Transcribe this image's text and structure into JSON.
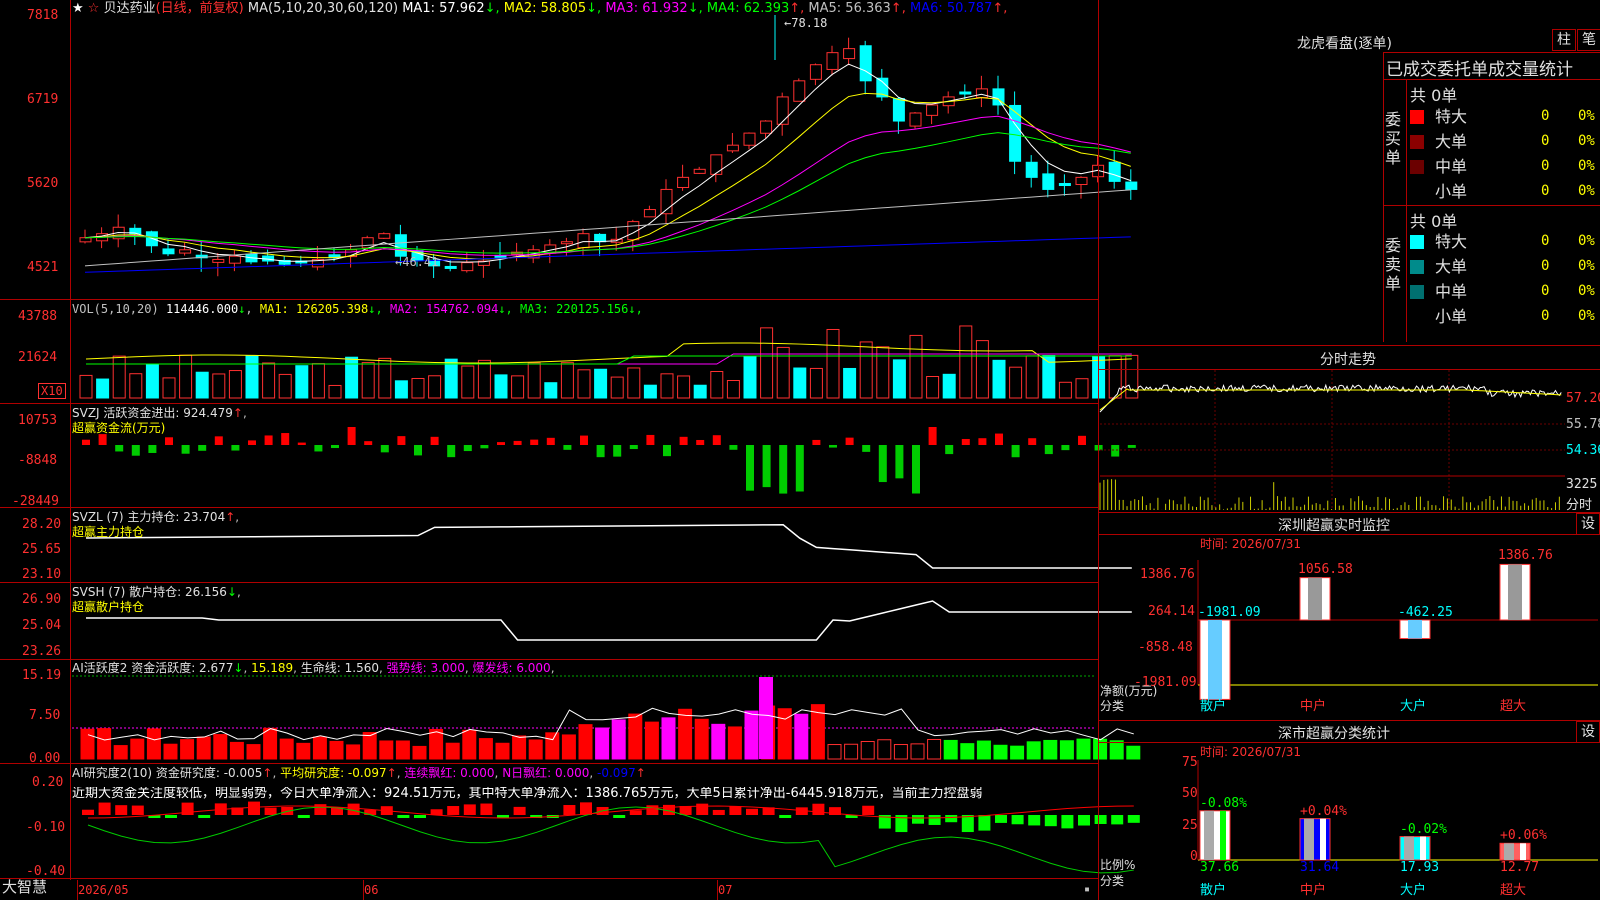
{
  "stock": {
    "name": "贝达药业",
    "period_label": "(日线，前复权)",
    "ma_text": "MA(5,10,20,30,60,120)",
    "ma_values": [
      {
        "label": "MA1:",
        "value": "57.962",
        "dir": "↓",
        "color": "#ffffff"
      },
      {
        "label": "MA2:",
        "value": "58.805",
        "dir": "↓",
        "color": "#ffff00"
      },
      {
        "label": "MA3:",
        "value": "61.932",
        "dir": "↓",
        "color": "#ff00ff"
      },
      {
        "label": "MA4:",
        "value": "62.393",
        "dir": "↑",
        "color": "#00ff00"
      },
      {
        "label": "MA5:",
        "value": "56.363",
        "dir": "↑",
        "color": "#c0c0c0"
      },
      {
        "label": "MA6:",
        "value": "50.787",
        "dir": "↑",
        "color": "#0000ff"
      }
    ],
    "high_marker": "78.18",
    "low_marker": "46.41",
    "y_ticks": [
      "7818",
      "6719",
      "5620",
      "4521"
    ]
  },
  "volume": {
    "title": "VOL(5,10,20)",
    "value": "114446.000",
    "ma": [
      {
        "label": "MA1:",
        "value": "126205.398",
        "color": "#ffff00"
      },
      {
        "label": "MA2:",
        "value": "154762.094",
        "color": "#ff00ff"
      },
      {
        "label": "MA3:",
        "value": "220125.156",
        "color": "#00ff00"
      }
    ],
    "y_ticks": [
      "43788",
      "21624"
    ],
    "unit": "X10"
  },
  "svzj": {
    "title": "SVZJ  活跃资金进出: 924.479",
    "dir": "↑",
    "sub": "超赢资金流(万元)",
    "y_ticks": [
      "10753",
      "-8848",
      "-28449"
    ]
  },
  "svzl": {
    "title": "SVZL (7) 主力持仓: 23.704",
    "dir": "↑",
    "sub": "超赢主力持仓",
    "y_ticks": [
      "28.20",
      "25.65",
      "23.10"
    ]
  },
  "svsh": {
    "title": "SVSH (7) 散户持仓: 26.156",
    "dir": "↓",
    "sub": "超赢散户持仓",
    "y_ticks": [
      "26.90",
      "25.04",
      "23.26"
    ]
  },
  "ai1": {
    "title": "AI活跃度2 资金活跃度: 2.677",
    "v2": "15.189",
    "v3": "生命线: 1.560",
    "v4": "强势线: 3.000",
    "v5": "爆发线: 6.000",
    "y_ticks": [
      "15.19",
      "7.50",
      "0.00"
    ]
  },
  "ai2": {
    "title": "AI研究度2(10) 资金研究度: -0.005",
    "v2": "平均研究度: -0.097",
    "v3": "连续飘红: 0.000",
    "v4": "N日飘红: 0.000",
    "v5": "-0.097",
    "desc": "近期大资金关注度较低，明显弱势，今日大单净流入：924.51万元，其中特大单净流入：1386.765万元，大单5日累计净出-6445.918万元，当前主力控盘弱",
    "y_ticks": [
      "0.20",
      "-0.10",
      "-0.40"
    ]
  },
  "xaxis": {
    "app": "大智慧",
    "labels": [
      "2026/05",
      "06",
      "07"
    ]
  },
  "right": {
    "dragon_title": "龙虎看盘(逐单)",
    "btn1": "柱",
    "btn2": "笔",
    "stats_header": "已成交委托单成交量统计",
    "buy_label": "委买单",
    "sell_label": "委卖单",
    "buy_total": "共 0单",
    "sell_total": "共 0单",
    "buy_rows": [
      {
        "name": "特大",
        "qty": "0",
        "pct": "0%",
        "color": "#ff0000"
      },
      {
        "name": "大单",
        "qty": "0",
        "pct": "0%",
        "color": "#8b0000"
      },
      {
        "name": "中单",
        "qty": "0",
        "pct": "0%",
        "color": "#6b0000"
      },
      {
        "name": "小单",
        "qty": "0",
        "pct": "0%",
        "color": "#000000"
      }
    ],
    "sell_rows": [
      {
        "name": "特大",
        "qty": "0",
        "pct": "0%",
        "color": "#00ffff"
      },
      {
        "name": "大单",
        "qty": "0",
        "pct": "0%",
        "color": "#008b8b"
      },
      {
        "name": "中单",
        "qty": "0",
        "pct": "0%",
        "color": "#007070"
      },
      {
        "name": "小单",
        "qty": "0",
        "pct": "0%",
        "color": "#000000"
      }
    ],
    "intraday_title": "分时走势",
    "intraday_prices": [
      "57.20",
      "55.78",
      "54.36"
    ],
    "intraday_vol": "3225",
    "intraday_unit": "分时",
    "monitor_title": "深圳超赢实时监控",
    "monitor_time": "时间: 2026/07/31",
    "monitor_y": [
      "1386.76",
      "264.14",
      "-858.48",
      "-1981.09"
    ],
    "monitor_axis_label1": "净额(万元)",
    "monitor_axis_label2": "分类",
    "monitor_values": [
      {
        "cat": "散户",
        "value": "-1981.09"
      },
      {
        "cat": "中户",
        "value": "1056.58"
      },
      {
        "cat": "大户",
        "value": "-462.25"
      },
      {
        "cat": "超大",
        "value": "1386.76"
      }
    ],
    "class_title": "深市超赢分类统计",
    "class_time": "时间: 2026/07/31",
    "class_y": [
      "75",
      "50",
      "25",
      "0"
    ],
    "class_axis_label1": "比例%",
    "class_axis_label2": "分类",
    "class_values": [
      {
        "cat": "散户",
        "value": "37.66",
        "chg": "-0.08%"
      },
      {
        "cat": "中户",
        "value": "31.64",
        "chg": "+0.04%"
      },
      {
        "cat": "大户",
        "value": "17.93",
        "chg": "-0.02%"
      },
      {
        "cat": "超大",
        "value": "12.77",
        "chg": "+0.06%"
      }
    ],
    "set_btn": "设"
  }
}
